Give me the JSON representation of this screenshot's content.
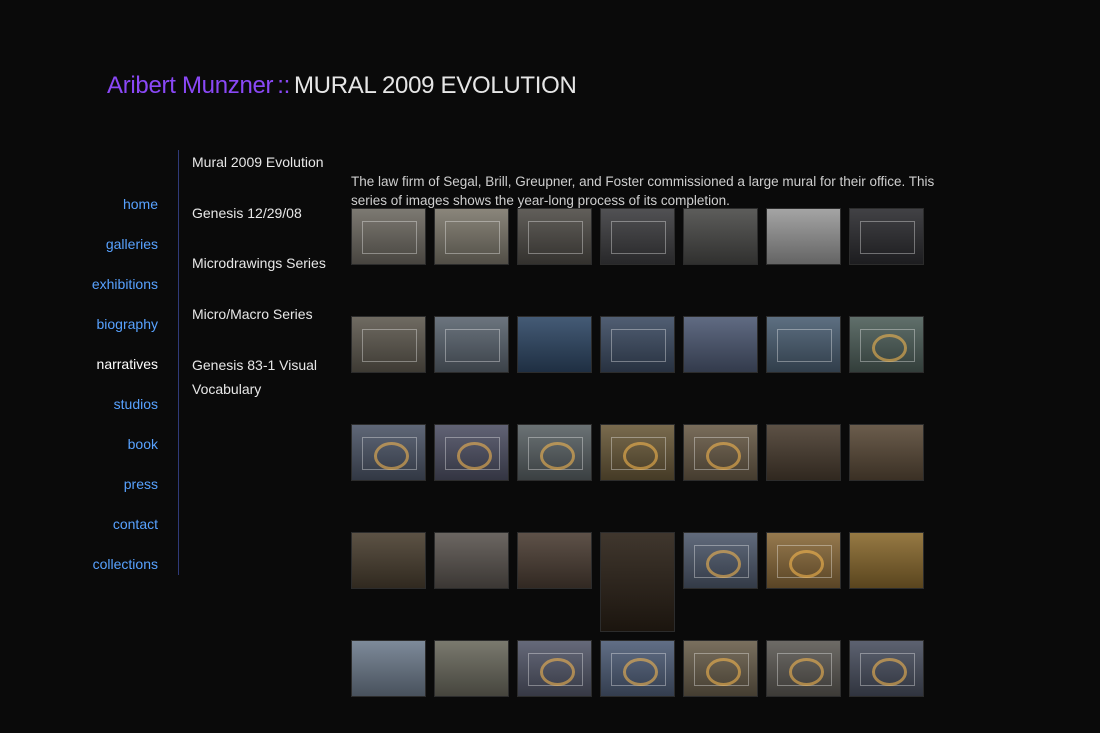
{
  "header": {
    "artist": "Aribert Munzner",
    "separator": "::",
    "section": "MURAL 2009 EVOLUTION"
  },
  "main_nav": [
    {
      "label": "home",
      "active": false
    },
    {
      "label": "galleries",
      "active": false
    },
    {
      "label": "exhibitions",
      "active": false
    },
    {
      "label": "biography",
      "active": false
    },
    {
      "label": "narratives",
      "active": true
    },
    {
      "label": "studios",
      "active": false
    },
    {
      "label": "book",
      "active": false
    },
    {
      "label": "press",
      "active": false
    },
    {
      "label": "contact",
      "active": false
    },
    {
      "label": "collections",
      "active": false
    }
  ],
  "sub_nav": [
    "Mural 2009 Evolution",
    "Genesis 12/29/08",
    "Microdrawings Series",
    "Micro/Macro Series",
    "Genesis 83-1 Visual Vocabulary"
  ],
  "intro": "The law firm of Segal, Brill, Greupner, and Foster commissioned a large mural for their office. This series of images shows the year-long process of its completion.",
  "colors": {
    "background": "#0a0a0a",
    "accent_purple": "#8a48f6",
    "link_blue": "#58a2ff",
    "active_white": "#ffffff",
    "divider": "#2f3a78"
  },
  "gallery": [
    [
      {
        "tone": "#6e6a62",
        "motif": "frame"
      },
      {
        "tone": "#7d786c",
        "motif": "frame"
      },
      {
        "tone": "#4f4c47",
        "motif": "frame"
      },
      {
        "tone": "#3d3d40",
        "motif": "frame"
      },
      {
        "tone": "#4a4a48",
        "motif": "plain"
      },
      {
        "tone": "#9a9a9a",
        "motif": "plain"
      },
      {
        "tone": "#2c2c30",
        "motif": "frame"
      }
    ],
    [
      {
        "tone": "#5f5a50",
        "motif": "frame"
      },
      {
        "tone": "#5b6570",
        "motif": "frame"
      },
      {
        "tone": "#2f4866",
        "motif": "plain"
      },
      {
        "tone": "#3d4c63",
        "motif": "frame"
      },
      {
        "tone": "#4e5a74",
        "motif": "plain"
      },
      {
        "tone": "#4b5f73",
        "motif": "frame"
      },
      {
        "tone": "#4e5f5a",
        "motif": "ring"
      }
    ],
    [
      {
        "tone": "#4d5668",
        "motif": "ring"
      },
      {
        "tone": "#4f5165",
        "motif": "ring"
      },
      {
        "tone": "#5a6265",
        "motif": "ring"
      },
      {
        "tone": "#6a5a3a",
        "motif": "ring"
      },
      {
        "tone": "#6a5c48",
        "motif": "ring"
      },
      {
        "tone": "#4a3d30",
        "motif": "plain"
      },
      {
        "tone": "#5a4a38",
        "motif": "plain"
      }
    ],
    [
      {
        "tone": "#4a3f30",
        "motif": "plain"
      },
      {
        "tone": "#5b5550",
        "motif": "plain"
      },
      {
        "tone": "#4c3e34",
        "motif": "plain"
      },
      {
        "tone": "#2a2016",
        "motif": "plain",
        "tall": true
      },
      {
        "tone": "#4f5a6d",
        "motif": "ring"
      },
      {
        "tone": "#8a6a3a",
        "motif": "ring"
      },
      {
        "tone": "#8a6a2e",
        "motif": "plain"
      }
    ],
    [
      {
        "tone": "#6f7d8e",
        "motif": "plain"
      },
      {
        "tone": "#6b6a5e",
        "motif": "plain"
      },
      {
        "tone": "#54586a",
        "motif": "ring"
      },
      {
        "tone": "#4f5e78",
        "motif": "ring"
      },
      {
        "tone": "#6a5f4c",
        "motif": "ring"
      },
      {
        "tone": "#5d5a55",
        "motif": "ring"
      },
      {
        "tone": "#4a5060",
        "motif": "ring"
      }
    ]
  ]
}
